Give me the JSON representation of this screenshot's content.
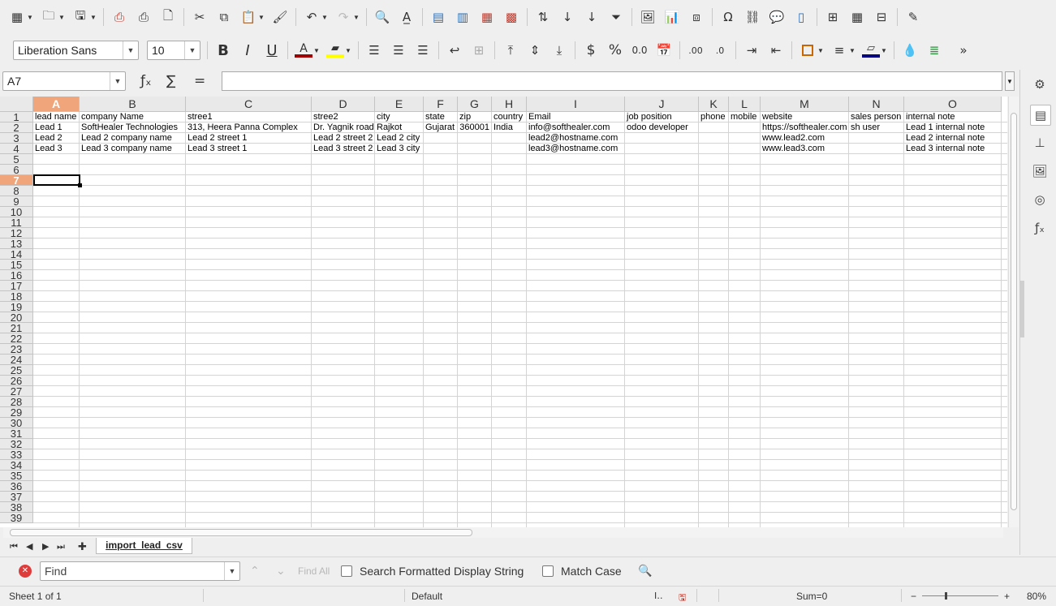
{
  "toolbar1": {
    "icons": [
      "new-spreadsheet",
      "open",
      "save",
      "export-pdf",
      "print",
      "print-preview",
      "cut",
      "copy",
      "paste",
      "clone-formatting",
      "undo",
      "redo",
      "find-replace",
      "spelling",
      "row",
      "column",
      "insert-cells",
      "delete-cells",
      "sort",
      "sort-ascending",
      "sort-descending",
      "autofilter",
      "insert-image",
      "insert-chart",
      "pivot-table",
      "special-character",
      "hyperlink",
      "comment",
      "headers-footers",
      "define-print-area",
      "freeze-rows",
      "split-window",
      "show-draw-functions"
    ]
  },
  "toolbar2": {
    "font_name": "Liberation Sans",
    "font_size": "10",
    "font_color": "#a00000",
    "highlight_color": "#ffff00",
    "border_color": "#000080",
    "border_style_color": "#cc6600"
  },
  "formula_bar": {
    "name_box": "A7",
    "formula": ""
  },
  "sheet": {
    "columns": [
      "A",
      "B",
      "C",
      "D",
      "E",
      "F",
      "G",
      "H",
      "I",
      "J",
      "K",
      "L",
      "M",
      "N",
      "O"
    ],
    "rows": [
      "1",
      "2",
      "3",
      "4",
      "5",
      "6",
      "7",
      "8",
      "9",
      "10",
      "11",
      "12",
      "13",
      "14",
      "15",
      "16",
      "17",
      "18",
      "19",
      "20",
      "21",
      "22",
      "23",
      "24",
      "25",
      "26",
      "27",
      "28",
      "29",
      "30",
      "31",
      "32",
      "33",
      "34",
      "35",
      "36",
      "37",
      "38",
      "39"
    ],
    "selected_column": "A",
    "selected_row": "7",
    "data": [
      [
        "lead name",
        "company Name",
        "stree1",
        "stree2",
        "city",
        "state",
        "zip",
        "country",
        "Email",
        "job position",
        "phone",
        "mobile",
        "website",
        "sales person",
        "internal note"
      ],
      [
        "Lead 1",
        "SoftHealer Technologies",
        "313, Heera Panna Complex",
        "Dr. Yagnik road",
        "Rajkot",
        "Gujarat",
        "360001",
        "India",
        "info@softhealer.com",
        "odoo developer",
        "",
        "",
        "https://softhealer.com",
        "sh user",
        "Lead 1 internal note"
      ],
      [
        "Lead 2",
        "Lead 2 company name",
        "Lead 2 street 1",
        "Lead 2 street 2",
        "Lead 2 city",
        "",
        "",
        "",
        "lead2@hostname.com",
        "",
        "",
        "",
        "www.lead2.com",
        "",
        "Lead 2 internal note"
      ],
      [
        "Lead 3",
        "Lead 3 company name",
        "Lead 3 street 1",
        "Lead 3 street 2",
        "Lead 3 city",
        "",
        "",
        "",
        "lead3@hostname.com",
        "",
        "",
        "",
        "www.lead3.com",
        "",
        "Lead 3 internal note"
      ]
    ]
  },
  "tabs": {
    "sheet_name": "import_lead_csv"
  },
  "findbar": {
    "placeholder": "Find",
    "find_all": "Find All",
    "search_formatted": "Search Formatted Display String",
    "match_case": "Match Case"
  },
  "status": {
    "sheet": "Sheet 1 of 1",
    "style": "Default",
    "sum": "Sum=0",
    "zoom": "80%",
    "zoom_fraction": 0.8
  }
}
